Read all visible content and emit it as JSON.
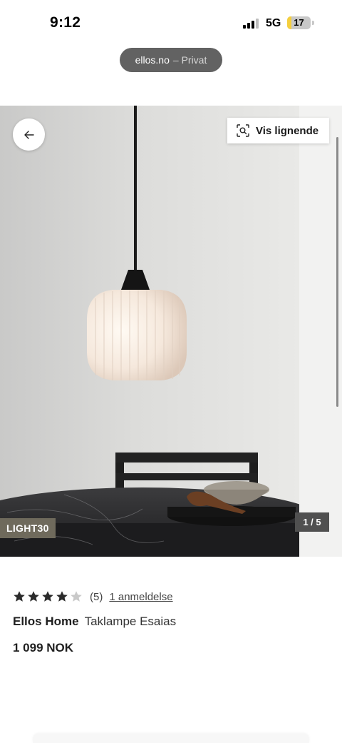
{
  "status_bar": {
    "time": "9:12",
    "network": "5G",
    "battery": "17",
    "battery_level": 0.17
  },
  "browser": {
    "domain": "ellos.no",
    "mode": "– Privat"
  },
  "gallery": {
    "similar_label": "Vis lignende",
    "badge": "LIGHT30",
    "counter": "1 / 5"
  },
  "product": {
    "rating": 4,
    "rating_max": 5,
    "review_count": "(5)",
    "review_link": "1 anmeldelse",
    "brand": "Ellos Home",
    "name": "Taklampe Esaias",
    "price": "1 099 NOK"
  },
  "icons": {
    "back": "arrow-left-icon",
    "similar": "visual-search-icon",
    "star": "star-icon"
  },
  "colors": {
    "star_filled": "#2b2b2b",
    "star_empty": "#c9c9c9",
    "badge_bg": "#6f6a5c",
    "counter_bg": "#505050",
    "url_pill_bg": "#626262"
  }
}
